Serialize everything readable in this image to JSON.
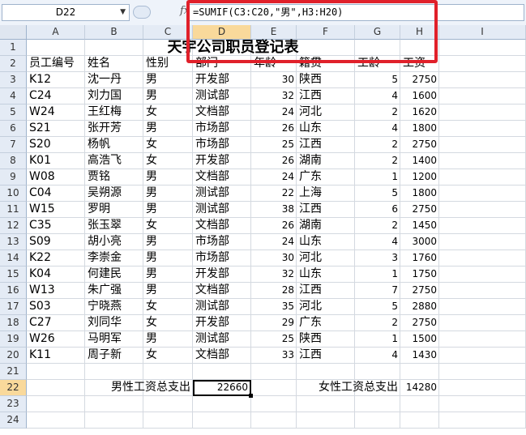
{
  "formula_bar": {
    "name_box": "D22",
    "fx": "fx",
    "formula": "=SUMIF(C3:C20,\"男\",H3:H20)"
  },
  "columns": [
    "A",
    "B",
    "C",
    "D",
    "E",
    "F",
    "G",
    "H",
    "I"
  ],
  "selected_column": "D",
  "rows": [
    "1",
    "2",
    "3",
    "4",
    "5",
    "6",
    "7",
    "8",
    "9",
    "10",
    "11",
    "12",
    "13",
    "14",
    "15",
    "16",
    "17",
    "18",
    "19",
    "20",
    "21",
    "22",
    "23",
    "24"
  ],
  "selected_row": "22",
  "sheet": {
    "title": "天宇公司职员登记表",
    "headers": [
      "员工编号",
      "姓名",
      "性别",
      "部门",
      "年龄",
      "籍贯",
      "工龄",
      "工资"
    ],
    "records": [
      [
        "K12",
        "沈一丹",
        "男",
        "开发部",
        "30",
        "陕西",
        "5",
        "2750"
      ],
      [
        "C24",
        "刘力国",
        "男",
        "测试部",
        "32",
        "江西",
        "4",
        "1600"
      ],
      [
        "W24",
        "王红梅",
        "女",
        "文档部",
        "24",
        "河北",
        "2",
        "1620"
      ],
      [
        "S21",
        "张开芳",
        "男",
        "市场部",
        "26",
        "山东",
        "4",
        "1800"
      ],
      [
        "S20",
        "杨帆",
        "女",
        "市场部",
        "25",
        "江西",
        "2",
        "2750"
      ],
      [
        "K01",
        "高浩飞",
        "女",
        "开发部",
        "26",
        "湖南",
        "2",
        "1400"
      ],
      [
        "W08",
        "贾铭",
        "男",
        "文档部",
        "24",
        "广东",
        "1",
        "1200"
      ],
      [
        "C04",
        "吴朔源",
        "男",
        "测试部",
        "22",
        "上海",
        "5",
        "1800"
      ],
      [
        "W15",
        "罗明",
        "男",
        "测试部",
        "38",
        "江西",
        "6",
        "2750"
      ],
      [
        "C35",
        "张玉翠",
        "女",
        "文档部",
        "26",
        "湖南",
        "2",
        "1450"
      ],
      [
        "S09",
        "胡小亮",
        "男",
        "市场部",
        "24",
        "山东",
        "4",
        "3000"
      ],
      [
        "K22",
        "李崇金",
        "男",
        "市场部",
        "30",
        "河北",
        "3",
        "1760"
      ],
      [
        "K04",
        "何建民",
        "男",
        "开发部",
        "32",
        "山东",
        "1",
        "1750"
      ],
      [
        "W13",
        "朱广强",
        "男",
        "文档部",
        "28",
        "江西",
        "7",
        "2750"
      ],
      [
        "S03",
        "宁晓燕",
        "女",
        "测试部",
        "35",
        "河北",
        "5",
        "2880"
      ],
      [
        "C27",
        "刘同华",
        "女",
        "开发部",
        "29",
        "广东",
        "2",
        "2750"
      ],
      [
        "W26",
        "马明军",
        "男",
        "测试部",
        "25",
        "陕西",
        "1",
        "1500"
      ],
      [
        "K11",
        "周子新",
        "女",
        "文档部",
        "33",
        "江西",
        "4",
        "1430"
      ]
    ],
    "summary": {
      "male_label": "男性工资总支出",
      "male_value": "22660",
      "female_label": "女性工资总支出",
      "female_value": "14280"
    }
  }
}
